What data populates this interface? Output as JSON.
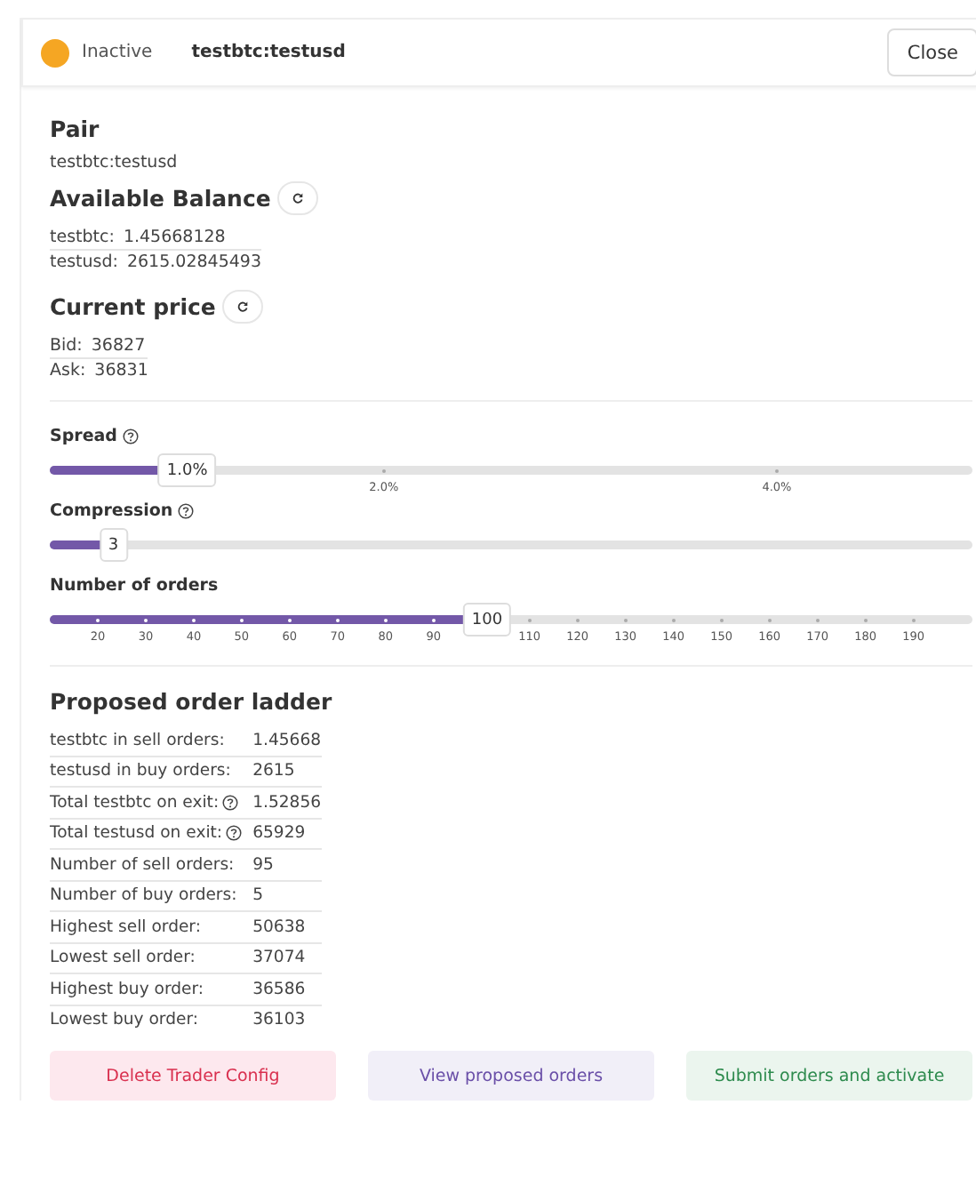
{
  "header": {
    "status": {
      "kind": "inactive",
      "label": "Inactive"
    },
    "pair": "testbtc:testusd",
    "close_button": "Close"
  },
  "pair": {
    "heading": "Pair",
    "value": "testbtc:testusd"
  },
  "balance": {
    "heading": "Available Balance",
    "rows": [
      {
        "label": "testbtc:",
        "value": "1.45668128"
      },
      {
        "label": "testusd:",
        "value": "2615.02845493"
      }
    ]
  },
  "price": {
    "heading": "Current price",
    "rows": [
      {
        "label": "Bid:",
        "value": "36827"
      },
      {
        "label": "Ask:",
        "value": "36831"
      }
    ]
  },
  "sliders": [
    {
      "label": "Spread",
      "help": true,
      "level": 0.149,
      "value": "1.0%",
      "ticks": [
        {
          "label": "2.0%"
        },
        {
          "label": "4.0%"
        }
      ]
    },
    {
      "label": "Compression",
      "help": true,
      "level": 0.069,
      "value": "3"
    },
    {
      "label": "Number of orders",
      "help": false,
      "level": 0.474,
      "value": "100",
      "ticks": [
        {
          "label": "20"
        },
        {
          "label": "30"
        },
        {
          "label": "40"
        },
        {
          "label": "50"
        },
        {
          "label": "60"
        },
        {
          "label": "70"
        },
        {
          "label": "80"
        },
        {
          "label": "90"
        },
        {
          "label": "110"
        },
        {
          "label": "120"
        },
        {
          "label": "130"
        },
        {
          "label": "140"
        },
        {
          "label": "150"
        },
        {
          "label": "160"
        },
        {
          "label": "170"
        },
        {
          "label": "180"
        },
        {
          "label": "190"
        }
      ]
    }
  ],
  "ladder": {
    "heading": "Proposed order ladder",
    "rows": [
      {
        "label": "testbtc in sell orders:",
        "help": false,
        "value": "1.45668"
      },
      {
        "label": "testusd in buy orders:",
        "help": false,
        "value": "2615"
      },
      {
        "label": "Total testbtc on exit:",
        "help": true,
        "value": "1.52856"
      },
      {
        "label": "Total testusd on exit:",
        "help": true,
        "value": "65929"
      },
      {
        "label": "Number of sell orders:",
        "help": false,
        "value": "95"
      },
      {
        "label": "Number of buy orders:",
        "help": false,
        "value": "5"
      },
      {
        "label": "Highest sell order:",
        "help": false,
        "value": "50638"
      },
      {
        "label": "Lowest sell order:",
        "help": false,
        "value": "37074"
      },
      {
        "label": "Highest buy order:",
        "help": false,
        "value": "36586"
      },
      {
        "label": "Lowest buy order:",
        "help": false,
        "value": "36103"
      }
    ]
  },
  "buttons": [
    {
      "kind": "danger",
      "label": "Delete Trader Config"
    },
    {
      "kind": "secondary",
      "label": "View proposed orders"
    },
    {
      "kind": "success",
      "label": "Submit orders and activate"
    }
  ]
}
